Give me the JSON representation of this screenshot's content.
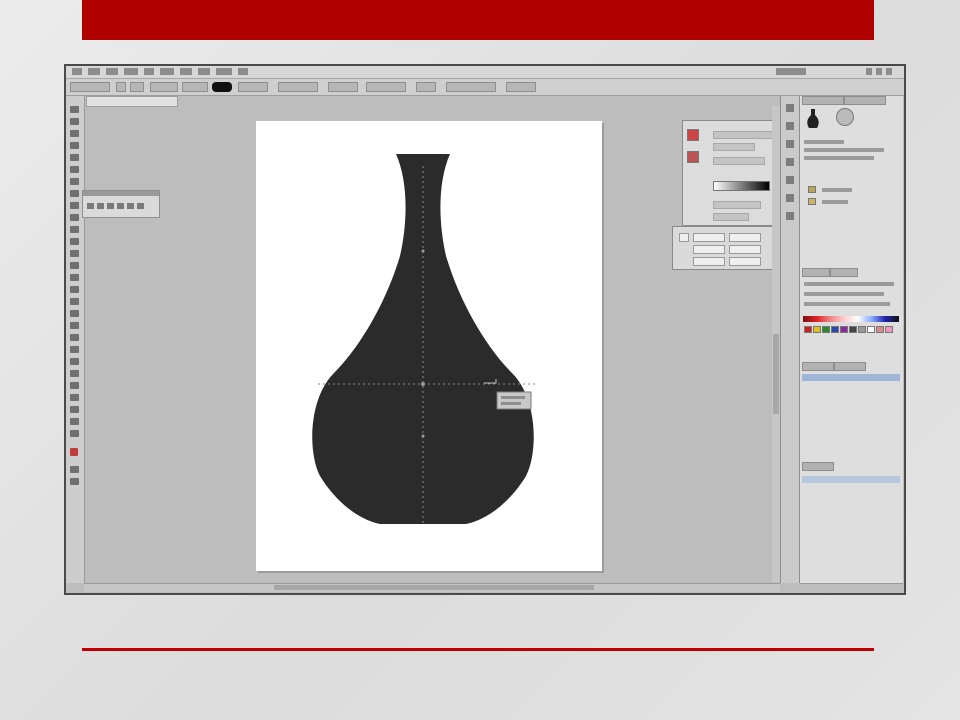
{
  "slide": {
    "band_color": "#b00000",
    "rule_color": "#c00000"
  },
  "app": {
    "icons": {
      "menubar": "menu-bar",
      "toolbox": "tools-panel",
      "gradient": "gradient-panel",
      "transform": "transform-panel",
      "layers": "layers-panel",
      "swatches": "swatches-panel"
    },
    "colors": {
      "workspace": "#bdbdbd",
      "artboard": "#ffffff",
      "vase_fill": "#2b2b2b",
      "guides": "#8a8a8a",
      "layer_highlight": "#9fb6d8"
    }
  }
}
